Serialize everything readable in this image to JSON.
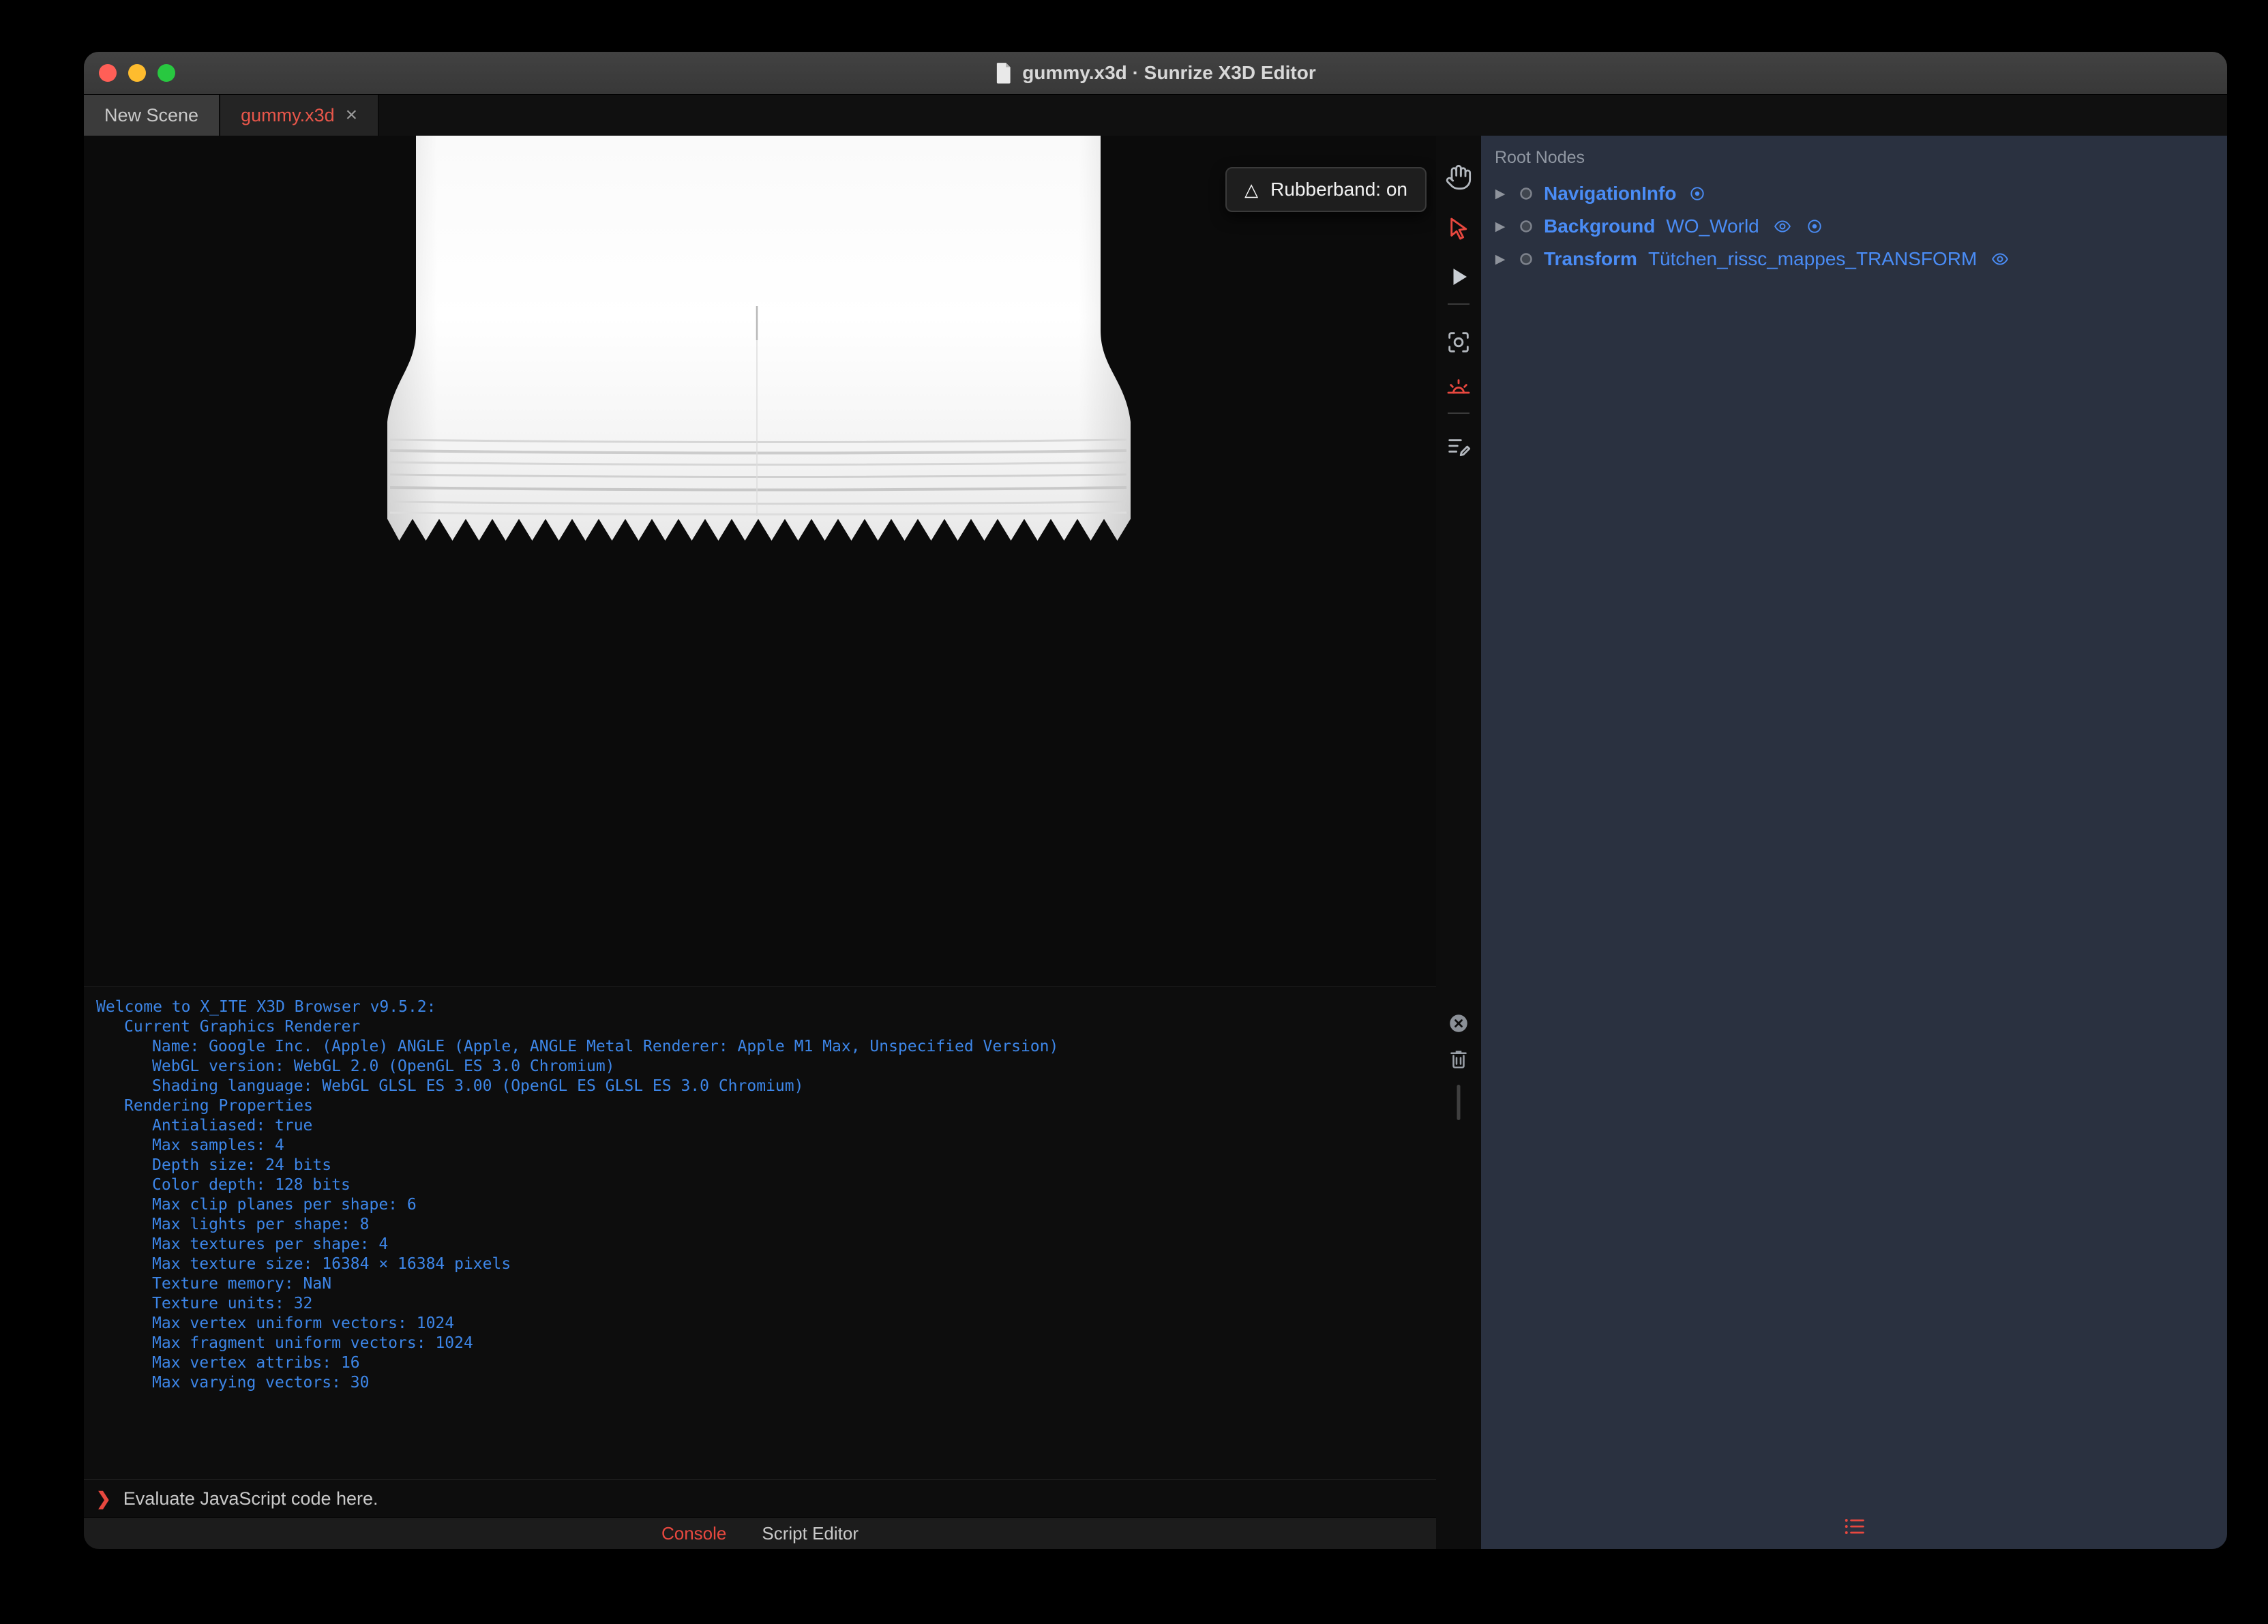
{
  "window": {
    "title": "gummy.x3d · Sunrize X3D Editor",
    "traffic_lights": [
      "close",
      "minimize",
      "zoom"
    ]
  },
  "tab_bar": {
    "tabs": [
      {
        "label": "New Scene",
        "active": false,
        "close_glyph": ""
      },
      {
        "label": "gummy.x3d",
        "active": true,
        "close_glyph": "×"
      }
    ]
  },
  "viewport": {
    "rubberband_badge": {
      "icon": "triangle-outline",
      "glyph": "△",
      "label": "Rubberband: on"
    }
  },
  "tool_strip": {
    "icons": [
      "pan-hand",
      "select-arrow",
      "play",
      "viewpoint-snapshot",
      "sunrise-light",
      "script-edit"
    ],
    "console_icons": [
      "clear-console",
      "trash"
    ]
  },
  "outline_panel": {
    "header": "Root Nodes",
    "nodes": [
      {
        "type": "NavigationInfo",
        "name": "",
        "icons": [
          "radio"
        ]
      },
      {
        "type": "Background",
        "name": "WO_World",
        "icons": [
          "eye",
          "radio"
        ]
      },
      {
        "type": "Transform",
        "name": "Tütchen_rissc_mappes_TRANSFORM",
        "icons": [
          "eye"
        ]
      }
    ]
  },
  "console": {
    "lines": [
      {
        "indent": 0,
        "text": "Welcome to X_ITE X3D Browser v9.5.2:"
      },
      {
        "indent": 1,
        "text": "Current Graphics Renderer"
      },
      {
        "indent": 2,
        "text": "Name: Google Inc. (Apple) ANGLE (Apple, ANGLE Metal Renderer: Apple M1 Max, Unspecified Version)"
      },
      {
        "indent": 2,
        "text": "WebGL version: WebGL 2.0 (OpenGL ES 3.0 Chromium)"
      },
      {
        "indent": 2,
        "text": "Shading language: WebGL GLSL ES 3.00 (OpenGL ES GLSL ES 3.0 Chromium)"
      },
      {
        "indent": 1,
        "text": "Rendering Properties"
      },
      {
        "indent": 2,
        "text": "Antialiased: true"
      },
      {
        "indent": 2,
        "text": "Max samples: 4"
      },
      {
        "indent": 2,
        "text": "Depth size: 24 bits"
      },
      {
        "indent": 2,
        "text": "Color depth: 128 bits"
      },
      {
        "indent": 2,
        "text": "Max clip planes per shape: 6"
      },
      {
        "indent": 2,
        "text": "Max lights per shape: 8"
      },
      {
        "indent": 2,
        "text": "Max textures per shape: 4"
      },
      {
        "indent": 2,
        "text": "Max texture size: 16384 × 16384 pixels"
      },
      {
        "indent": 2,
        "text": "Texture memory: NaN"
      },
      {
        "indent": 2,
        "text": "Texture units: 32"
      },
      {
        "indent": 2,
        "text": "Max vertex uniform vectors: 1024"
      },
      {
        "indent": 2,
        "text": "Max fragment uniform vectors: 1024"
      },
      {
        "indent": 2,
        "text": "Max vertex attribs: 16"
      },
      {
        "indent": 2,
        "text": "Max varying vectors: 30"
      }
    ],
    "prompt": {
      "chevron": "❯",
      "placeholder": "Evaluate JavaScript code here."
    }
  },
  "bottom_bar": {
    "tabs": [
      {
        "label": "Console",
        "active": true
      },
      {
        "label": "Script Editor",
        "active": false
      }
    ]
  },
  "colors": {
    "accent_red": "#e8483f",
    "node_blue": "#4a8cf5",
    "console_blue": "#3d86e8",
    "panel_bg": "#2a3140"
  }
}
